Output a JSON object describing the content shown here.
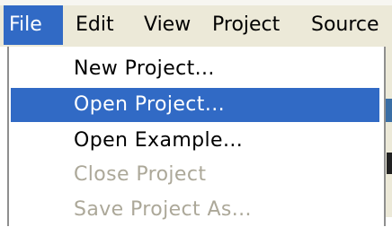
{
  "menubar": {
    "items": [
      {
        "label": "File",
        "active": true
      },
      {
        "label": "Edit",
        "active": false
      },
      {
        "label": "View",
        "active": false
      },
      {
        "label": "Project",
        "active": false
      },
      {
        "label": "Source",
        "active": false
      }
    ]
  },
  "file_menu": {
    "items": [
      {
        "label": "New Project...",
        "enabled": true,
        "highlighted": false
      },
      {
        "label": "Open Project...",
        "enabled": true,
        "highlighted": true
      },
      {
        "label": "Open Example...",
        "enabled": true,
        "highlighted": false
      },
      {
        "label": "Close Project",
        "enabled": false,
        "highlighted": false
      },
      {
        "label": "Save Project As...",
        "enabled": false,
        "highlighted": false
      }
    ]
  },
  "colors": {
    "menubar_bg": "#ece9d8",
    "highlight_bg": "#316ac5",
    "highlight_text": "#ffffff",
    "disabled_text": "#aca899",
    "menu_text": "#000000"
  }
}
